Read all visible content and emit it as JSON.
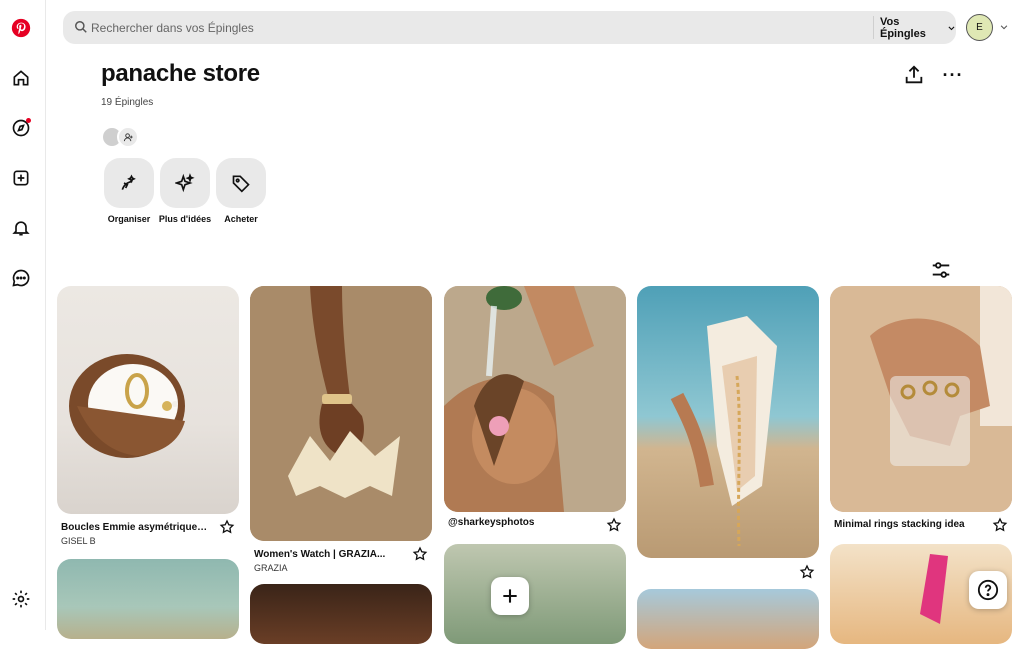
{
  "search": {
    "placeholder": "Rechercher dans vos Épingles"
  },
  "scope": {
    "label": "Vos Épingles"
  },
  "account": {
    "initial": "E"
  },
  "board": {
    "title": "panache store",
    "pin_count": "19 Épingles"
  },
  "actions": [
    {
      "label": "Organiser",
      "icon": "organize-icon"
    },
    {
      "label": "Plus d'idées",
      "icon": "sparkle-icon"
    },
    {
      "label": "Acheter",
      "icon": "tag-icon"
    }
  ],
  "pins": [
    {
      "title": "Boucles Emmie asymétriques en...",
      "subtitle": "GISEL B"
    },
    {
      "title": "Women's Watch | GRAZIA...",
      "subtitle": "GRAZIA"
    },
    {
      "title": "@sharkeysphotos",
      "subtitle": ""
    },
    {
      "title": "",
      "subtitle": ""
    },
    {
      "title": "Minimal rings stacking idea",
      "subtitle": ""
    }
  ],
  "colors": {
    "brand": "#e60023",
    "chip": "#e9e9e9",
    "avatar": "#dfe8b4"
  }
}
